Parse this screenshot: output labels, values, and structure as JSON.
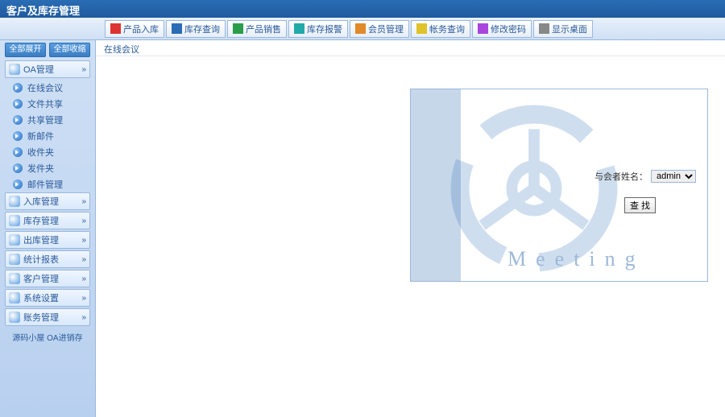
{
  "app": {
    "title": "客户及库存管理"
  },
  "toolbar": [
    {
      "label": "产品入库",
      "icon": "arrow-right-icon",
      "cls": "i-red"
    },
    {
      "label": "库存查询",
      "icon": "search-icon",
      "cls": "i-blue"
    },
    {
      "label": "产品销售",
      "icon": "arrow-left-icon",
      "cls": "i-grn"
    },
    {
      "label": "库存报警",
      "icon": "alert-icon",
      "cls": "i-cyan"
    },
    {
      "label": "会员管理",
      "icon": "user-icon",
      "cls": "i-org"
    },
    {
      "label": "帐务查询",
      "icon": "book-icon",
      "cls": "i-ylw"
    },
    {
      "label": "修改密码",
      "icon": "lock-icon",
      "cls": "i-mag"
    },
    {
      "label": "显示桌面",
      "icon": "desktop-icon",
      "cls": "i-gry"
    }
  ],
  "side_actions": {
    "expand": "全部展开",
    "collapse": "全部收缩"
  },
  "sidebar": [
    {
      "label": "OA管理",
      "icon": "cursor-icon",
      "expanded": true,
      "items": [
        {
          "label": "在线会议"
        },
        {
          "label": "文件共享"
        },
        {
          "label": "共享管理"
        },
        {
          "label": "新邮件"
        },
        {
          "label": "收件夹"
        },
        {
          "label": "发件夹"
        },
        {
          "label": "邮件管理"
        }
      ]
    },
    {
      "label": "入库管理",
      "icon": "in-icon"
    },
    {
      "label": "库存管理",
      "icon": "stock-icon"
    },
    {
      "label": "出库管理",
      "icon": "out-icon"
    },
    {
      "label": "统计报表",
      "icon": "chart-icon"
    },
    {
      "label": "客户管理",
      "icon": "client-icon"
    },
    {
      "label": "系统设置",
      "icon": "gear-icon"
    },
    {
      "label": "账务管理",
      "icon": "account-icon"
    }
  ],
  "footer": "源码小屋 OA进销存",
  "main": {
    "crumb": "在线会议",
    "panel": {
      "watermark": "Meeting",
      "field_label": "与会者姓名：",
      "selected": "admin",
      "options": [
        "admin"
      ],
      "submit": "查 找"
    }
  }
}
